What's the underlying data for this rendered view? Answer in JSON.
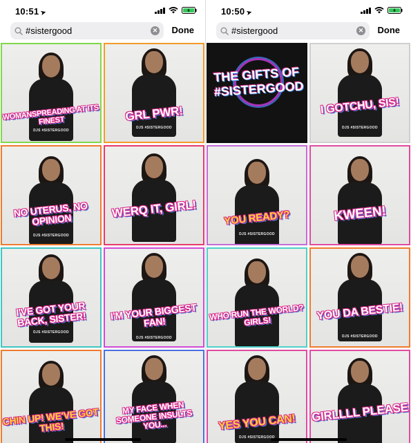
{
  "screens": [
    {
      "status": {
        "time": "10:51"
      },
      "search": {
        "value": "#sistergood",
        "done_label": "Done"
      },
      "tiles": [
        {
          "caption": "WOMANSPREADING AT ITS FINEST",
          "tag": "DJS #SISTERGOOD",
          "border": "#7fd84a",
          "style": "white"
        },
        {
          "caption": "GRL PWR!",
          "tag": "DJS #SISTERGOOD",
          "border": "#f29a2a",
          "style": "white"
        },
        {
          "caption": "NO UTERUS, NO OPINION",
          "tag": "DJS #SISTERGOOD",
          "border": "#f07b2e",
          "style": "white"
        },
        {
          "caption": "WERQ IT, GIRL!",
          "tag": "",
          "border": "#e8396b",
          "style": "white"
        },
        {
          "caption": "I'VE GOT YOUR BACK, SISTER!",
          "tag": "DJS #SISTERGOOD",
          "border": "#3cc6c2",
          "style": "white"
        },
        {
          "caption": "I'M YOUR BIGGEST FAN!",
          "tag": "DJS #SISTERGOOD",
          "border": "#d04ad6",
          "style": "white"
        },
        {
          "caption": "CHIN UP! WE'VE GOT THIS!",
          "tag": "",
          "border": "#f07b2e",
          "style": "yellow"
        },
        {
          "caption": "MY FACE WHEN SOMEONE INSULTS YOU...",
          "tag": "",
          "border": "#4a6fe0",
          "style": "white"
        }
      ]
    },
    {
      "status": {
        "time": "10:50"
      },
      "search": {
        "value": "#sistergood",
        "done_label": "Done"
      },
      "tiles": [
        {
          "caption": "THE GIFTS OF #SISTERGOOD",
          "tag": "",
          "border": "#121212",
          "style": "title"
        },
        {
          "caption": "I GOTCHU, SIS!",
          "tag": "DJS #SISTERGOOD",
          "border": "#cfcfcf",
          "style": "white"
        },
        {
          "caption": "YOU READY?",
          "tag": "DJS #SISTERGOOD",
          "border": "#c46ad8",
          "style": "yellow"
        },
        {
          "caption": "KWEEN!",
          "tag": "",
          "border": "#e04aa0",
          "style": "white"
        },
        {
          "caption": "WHO RUN THE WORLD? GIRLS!",
          "tag": "",
          "border": "#4ed0c8",
          "style": "white"
        },
        {
          "caption": "YOU DA BESTIE!",
          "tag": "DJS #SISTERGOOD",
          "border": "#f07b2e",
          "style": "white"
        },
        {
          "caption": "YES YOU CAN!",
          "tag": "DJS #SISTERGOOD",
          "border": "#e04aa0",
          "style": "yellow"
        },
        {
          "caption": "GIRLLLL PLEASE",
          "tag": "",
          "border": "#e04aa0",
          "style": "white"
        }
      ]
    }
  ],
  "icons": {
    "search": "search-icon",
    "clear": "clear-icon",
    "signal": "signal-icon",
    "wifi": "wifi-icon",
    "battery": "battery-icon"
  },
  "colors": {
    "search_bg": "#eeeef0",
    "caption_fill": "#ffd43a",
    "caption_outline": "#d9268a",
    "caption_shadow": "#3b7de0",
    "battery": "#34c759"
  }
}
